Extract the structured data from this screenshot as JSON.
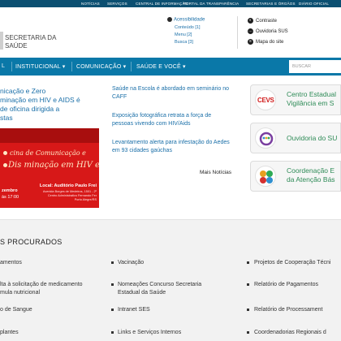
{
  "topbar": {
    "items": [
      "NOTÍCIAS",
      "SERVIÇOS",
      "CENTRAL DE INFORMAÇÃO",
      "PORTAL DA TRANSPARÊNCIA",
      "SECRETARIAS E ÓRGÃOS",
      "DIÁRIO OFICIAL"
    ]
  },
  "header": {
    "title_line1": "SECRETARIA DA",
    "title_line2": "SAÚDE",
    "accessibility": "Acessibilidade",
    "conteudo": "Conteúdo [1]",
    "menu": "Menu [2]",
    "busca": "Busca [3]",
    "contrast": "Contraste",
    "ouvidoria": "Ouvidoria SUS",
    "sitemap": "Mapa do site"
  },
  "nav": {
    "items": [
      "L",
      "INSTITUCIONAL ▾",
      "COMUNICAÇÃO ▾",
      "SAÚDE E VOCÊ ▾"
    ],
    "search_placeholder": "BUSCAR"
  },
  "featured": {
    "title_lines": [
      "nicação e Zero",
      "minação em HIV e AIDS é",
      " de oficina dirigida a",
      "stas"
    ],
    "banner_line1": "cina de Comunicação e",
    "banner_line2": "Dis minação em HIV e i",
    "banner_date_label": "zembro",
    "banner_time": "às 17:00",
    "banner_location": "Local: Auditório Paulo Frei",
    "banner_addr1": "Avenida Borges de Medeiros, 1501 - 2º",
    "banner_addr2": "Centro Administrativo Fernando Fer",
    "banner_addr3": "Porto Alegre/RS"
  },
  "news": {
    "items": [
      "Saúde na Escola é abordado em seminário no CAFF",
      "Exposição fotográfica retrata a força de pessoas vivendo com HIV/Aids",
      "Levantamento alerta para infestação do Aedes em 93 cidades gaúchas"
    ],
    "more": "Mais Notícias"
  },
  "cards": [
    {
      "icon": "CEVS",
      "line1": "Centro Estadual",
      "line2": "Vigilância em S"
    },
    {
      "icon": "",
      "line1": "Ouvidoria do SU",
      "line2": ""
    },
    {
      "icon": "",
      "line1": "Coordenação E",
      "line2": "da Atenção Bás"
    }
  ],
  "most_searched": {
    "title": "S PROCURADOS",
    "col1": [
      "amentos",
      "lta à solicitação de medicamento",
      "mula nutricional",
      "o de Sangue",
      "plantes"
    ],
    "col2": [
      "Vacinação",
      "Nomeações Concurso Secretaria",
      "Estadual da Saúde",
      "Intranet SES",
      "Links e Serviços Internos"
    ],
    "col3": [
      "Projetos de Cooperação Técni",
      "Relatório de Pagamentos",
      "Relatório de Processament",
      "Coordenadorias Regionais d"
    ]
  },
  "colors": {
    "topbar": "#0b4f71",
    "nav": "#0a78a8",
    "link": "#1a6fa8",
    "card_text": "#2e8b57",
    "banner": "#d71818"
  }
}
